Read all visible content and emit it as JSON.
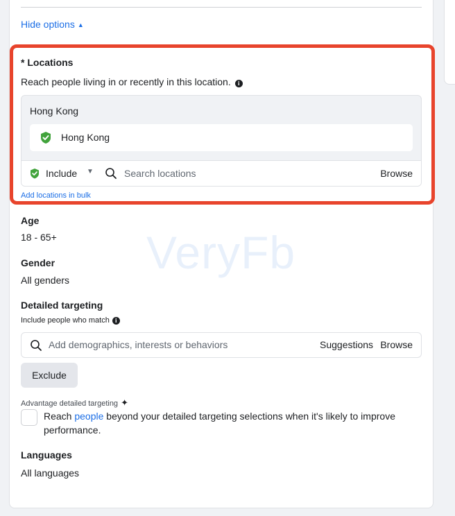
{
  "hide_options": {
    "label": "Hide options",
    "caret": "▲"
  },
  "locations": {
    "title": "* Locations",
    "description": "Reach people living in or recently in this location.",
    "group_label": "Hong Kong",
    "selected": [
      {
        "name": "Hong Kong"
      }
    ],
    "include_label": "Include",
    "search_placeholder": "Search locations",
    "browse": "Browse",
    "bulk_link": "Add locations in bulk"
  },
  "age": {
    "label": "Age",
    "value": "18 - 65+"
  },
  "gender": {
    "label": "Gender",
    "value": "All genders"
  },
  "detailed_targeting": {
    "label": "Detailed targeting",
    "sublabel": "Include people who match",
    "search_placeholder": "Add demographics, interests or behaviors",
    "suggestions": "Suggestions",
    "browse": "Browse",
    "exclude": "Exclude"
  },
  "advantage": {
    "label": "Advantage detailed targeting",
    "text_before": "Reach ",
    "link": "people",
    "text_after": " beyond your detailed targeting selections when it's likely to improve performance."
  },
  "languages": {
    "label": "Languages",
    "value": "All languages"
  },
  "watermark": "VeryFb",
  "colors": {
    "link": "#1b6ee6",
    "highlight_border": "#e8442c",
    "location_pin": "#42a33c",
    "panel_bg": "#f0f2f5"
  }
}
